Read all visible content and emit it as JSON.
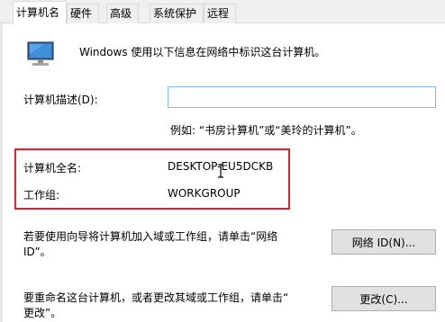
{
  "tabs": [
    {
      "label": "计算机名",
      "active": true
    },
    {
      "label": "硬件",
      "active": false
    },
    {
      "label": "高级",
      "active": false
    },
    {
      "label": "系统保护",
      "active": false
    },
    {
      "label": "远程",
      "active": false
    }
  ],
  "info_text": "Windows 使用以下信息在网络中标识这台计算机。",
  "description": {
    "label": "计算机描述(D):",
    "value": "",
    "example": "例如: “书房计算机”或“美玲的计算机”。"
  },
  "full_name": {
    "label": "计算机全名:",
    "value": "DESKTOP-EU5DCKB"
  },
  "workgroup": {
    "label": "工作组:",
    "value": "WORKGROUP"
  },
  "network_id": {
    "text_line1": "若要使用向导将计算机加入域或工作组，请单击“网络",
    "text_line2": "ID”。",
    "button": "网络 ID(N)..."
  },
  "rename": {
    "text_line1": "要重命名这台计算机，或者更改其域或工作组，请单击“",
    "text_line2": "更改”。",
    "button": "更改(C)..."
  },
  "colors": {
    "highlight_box": "#e0202a",
    "focus_border": "#7fbbe5"
  }
}
